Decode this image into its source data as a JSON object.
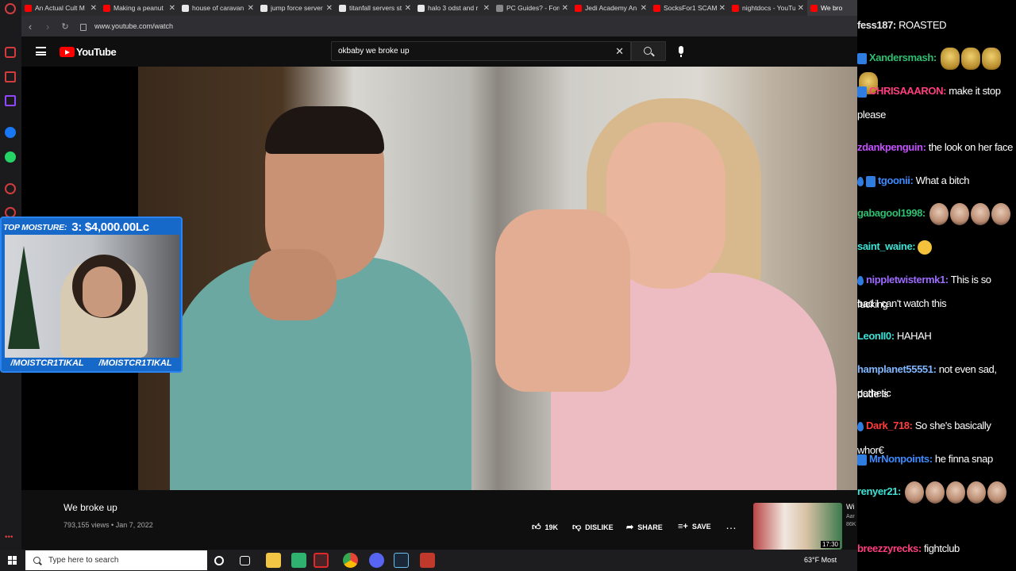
{
  "browser": {
    "tabs": [
      {
        "label": "An Actual Cult M",
        "color": "#ff0000"
      },
      {
        "label": "Making a peanut",
        "color": "#ff0000"
      },
      {
        "label": "house of caravan",
        "color": "#e8e8e8"
      },
      {
        "label": "jump force server",
        "color": "#e8e8e8"
      },
      {
        "label": "titanfall servers st",
        "color": "#e8e8e8"
      },
      {
        "label": "halo 3 odst and r",
        "color": "#e8e8e8"
      },
      {
        "label": "PC Guides? - Foru",
        "color": "#888888"
      },
      {
        "label": "Jedi Academy An",
        "color": "#ff0000"
      },
      {
        "label": "SocksFor1 SCAM",
        "color": "#ff0000"
      },
      {
        "label": "nightdocs - YouTu",
        "color": "#ff0000"
      },
      {
        "label": "We bro",
        "color": "#ff0000"
      }
    ],
    "url": "www.youtube.com/watch"
  },
  "youtube": {
    "logo_text": "YouTube",
    "search_value": "okbaby we broke up",
    "video_title": "We broke up",
    "views": "793,155 views",
    "date": "Jan 7, 2022",
    "actions": {
      "like": "19K",
      "dislike": "DISLIKE",
      "share": "SHARE",
      "save": "SAVE"
    },
    "next_video": {
      "duration": "17:30",
      "title_fragment": "Wi",
      "sub_fragment_1": "Aar",
      "sub_fragment_2": "86K"
    }
  },
  "facecam": {
    "top_label": "TOP MOISTURE:",
    "top_amount": "3: $4,000.00Lc",
    "handle_left": "/MOISTCR1TIKAL",
    "handle_right": "/MOISTCR1TIKAL"
  },
  "chat": [
    {
      "user": "fess187:",
      "color": "#e8e8e8",
      "text": "ROASTED",
      "badge": "none"
    },
    {
      "user": "Xandersmash:",
      "color": "#2fbf71",
      "text": "",
      "badge": "crown",
      "emotes": 4,
      "emote_style": "gold"
    },
    {
      "user": "CHRISAAARON:",
      "color": "#ff3d7f",
      "text": "make it stop",
      "badge": "crown"
    },
    {
      "user": "",
      "color": "#ffffff",
      "text": "please",
      "badge": "none"
    },
    {
      "user": "zdankpenguin:",
      "color": "#c452ff",
      "text": "the look on her face",
      "badge": "none"
    },
    {
      "user": "tgoonii:",
      "color": "#3d8bff",
      "text": "What a bitch",
      "badge": "drop-crown"
    },
    {
      "user": "gabagool1998:",
      "color": "#2fbf71",
      "text": "",
      "badge": "none",
      "emotes": 4,
      "emote_style": "face"
    },
    {
      "user": "saint_waine:",
      "color": "#3ee3d6",
      "text": "",
      "badge": "none",
      "lol": true
    },
    {
      "user": "nippletwistermk1:",
      "color": "#9d6bff",
      "text": "This is so fucking",
      "badge": "drop"
    },
    {
      "user": "",
      "color": "#ffffff",
      "text": "bad I can't watch this",
      "badge": "none"
    },
    {
      "user": "LeonII0:",
      "color": "#3ee3d6",
      "text": "HAHAH",
      "badge": "none"
    },
    {
      "user": "hamplanet55551:",
      "color": "#7fb7ff",
      "text": "not even sad, dude is",
      "badge": "none"
    },
    {
      "user": "",
      "color": "#ffffff",
      "text": "pathetic",
      "badge": "none"
    },
    {
      "user": "Dark_718:",
      "color": "#ff3d3d",
      "text": "So she's basically whor€",
      "badge": "drop"
    },
    {
      "user": "MrNonpoints:",
      "color": "#3d8bff",
      "text": "he finna snap",
      "badge": "crown"
    },
    {
      "user": "renyer21:",
      "color": "#3ee3d6",
      "text": "",
      "badge": "none",
      "emotes": 5,
      "emote_style": "face"
    },
    {
      "user": "breezzyrecks:",
      "color": "#ff3d7f",
      "text": "fightclub",
      "badge": "none"
    }
  ],
  "taskbar": {
    "search_placeholder": "Type here to search",
    "weather": "63°F  Most"
  }
}
